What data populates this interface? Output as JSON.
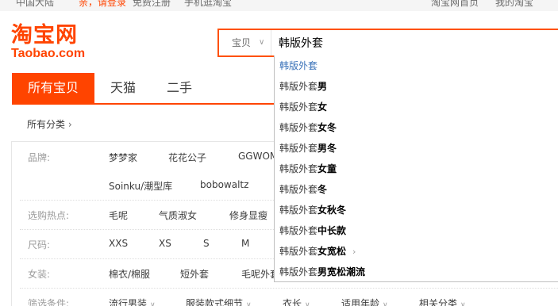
{
  "topbar": {
    "left_items": [
      "中国大陆",
      "亲，请登录",
      "免费注册",
      "手机逛淘宝"
    ],
    "right_items": [
      "淘宝网首页",
      "我的淘宝"
    ]
  },
  "logo": {
    "cn": "淘宝网",
    "en": "Taobao.com"
  },
  "search": {
    "type_label": "宝贝",
    "query": "韩版外套"
  },
  "suggestions": [
    {
      "prefix": "韩版外套",
      "suffix": ""
    },
    {
      "prefix": "韩版外套",
      "suffix": "男"
    },
    {
      "prefix": "韩版外套",
      "suffix": "女"
    },
    {
      "prefix": "韩版外套",
      "suffix": "女冬"
    },
    {
      "prefix": "韩版外套",
      "suffix": "男冬"
    },
    {
      "prefix": "韩版外套",
      "suffix": "女童"
    },
    {
      "prefix": "韩版外套",
      "suffix": "冬"
    },
    {
      "prefix": "韩版外套",
      "suffix": "女秋冬"
    },
    {
      "prefix": "韩版外套",
      "suffix": "中长款"
    },
    {
      "prefix": "韩版外套",
      "suffix": "女宽松"
    },
    {
      "prefix": "韩版外套",
      "suffix": "男宽松潮流"
    }
  ],
  "tabs": [
    "所有宝贝",
    "天猫",
    "二手"
  ],
  "crumb": "所有分类",
  "filters": {
    "brand_label": "品牌:",
    "brand_options_row1": [
      "梦梦家",
      "花花公子",
      "GGWOM"
    ],
    "brand_options_row2": [
      "Soinku/潮型库",
      "bobowaltz"
    ],
    "hot_label": "选购热点:",
    "hot_options": [
      "毛呢",
      "气质淑女",
      "修身显瘦"
    ],
    "size_label": "尺码:",
    "size_options": [
      "XXS",
      "XS",
      "S",
      "M"
    ],
    "women_label": "女装:",
    "women_options": [
      "棉衣/棉服",
      "短外套",
      "毛呢外套"
    ],
    "cond_label": "筛选条件:",
    "cond_options": [
      "流行男装",
      "服装款式细节",
      "衣长",
      "适用年龄",
      "相关分类"
    ]
  }
}
